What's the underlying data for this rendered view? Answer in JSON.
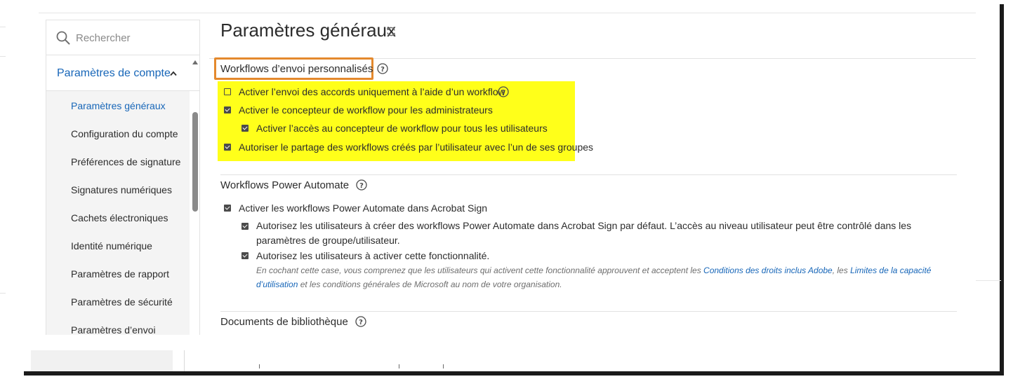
{
  "sidebar": {
    "search_placeholder": "Rechercher",
    "account_section": "Paramètres de compte",
    "items": [
      {
        "label": "Paramètres généraux",
        "active": true
      },
      {
        "label": "Configuration du compte",
        "active": false
      },
      {
        "label": "Préférences de signature",
        "active": false
      },
      {
        "label": "Signatures numériques",
        "active": false
      },
      {
        "label": "Cachets électroniques",
        "active": false
      },
      {
        "label": "Identité numérique",
        "active": false
      },
      {
        "label": "Paramètres de rapport",
        "active": false
      },
      {
        "label": "Paramètres de sécurité",
        "active": false
      },
      {
        "label": "Paramètres d’envoi",
        "active": false
      }
    ]
  },
  "main": {
    "title": "Paramètres généraux",
    "sections": {
      "custom_workflows": {
        "title": "Workflows d’envoi personnalisés",
        "options": [
          {
            "label": "Activer l’envoi des accords uniquement à l’aide d’un workflow",
            "checked": false
          },
          {
            "label": "Activer le concepteur de workflow pour les administrateurs",
            "checked": true
          },
          {
            "label": "Activer l’accès au concepteur de workflow pour tous les utilisateurs",
            "checked": true
          },
          {
            "label": "Autoriser le partage des workflows créés par l’utilisateur avec l’un de ses groupes",
            "checked": true
          }
        ]
      },
      "power_automate": {
        "title": "Workflows Power Automate",
        "options": [
          {
            "label": "Activer les workflows Power Automate dans Acrobat Sign",
            "checked": true
          },
          {
            "label": "Autorisez les utilisateurs à créer des workflows Power Automate dans Acrobat Sign par défaut. L’accès au niveau utilisateur peut être contrôlé dans les paramètres de groupe/utilisateur.",
            "checked": true
          },
          {
            "label": "Autorisez les utilisateurs à activer cette fonctionnalité.",
            "checked": true
          }
        ],
        "note": {
          "part1": "En cochant cette case, vous comprenez que les utilisateurs qui activent cette fonctionnalité approuvent et acceptent les ",
          "link1": "Conditions des droits inclus Adobe",
          "part2": ", les ",
          "link2": "Limites de la capacité d’utilisation",
          "part3": " et les conditions générales de Microsoft au nom de votre organisation."
        }
      },
      "library": {
        "title": "Documents de bibliothèque"
      }
    }
  },
  "colors": {
    "link": "#1766b8",
    "highlight": "#ffff1a",
    "callout": "#e4892d"
  }
}
